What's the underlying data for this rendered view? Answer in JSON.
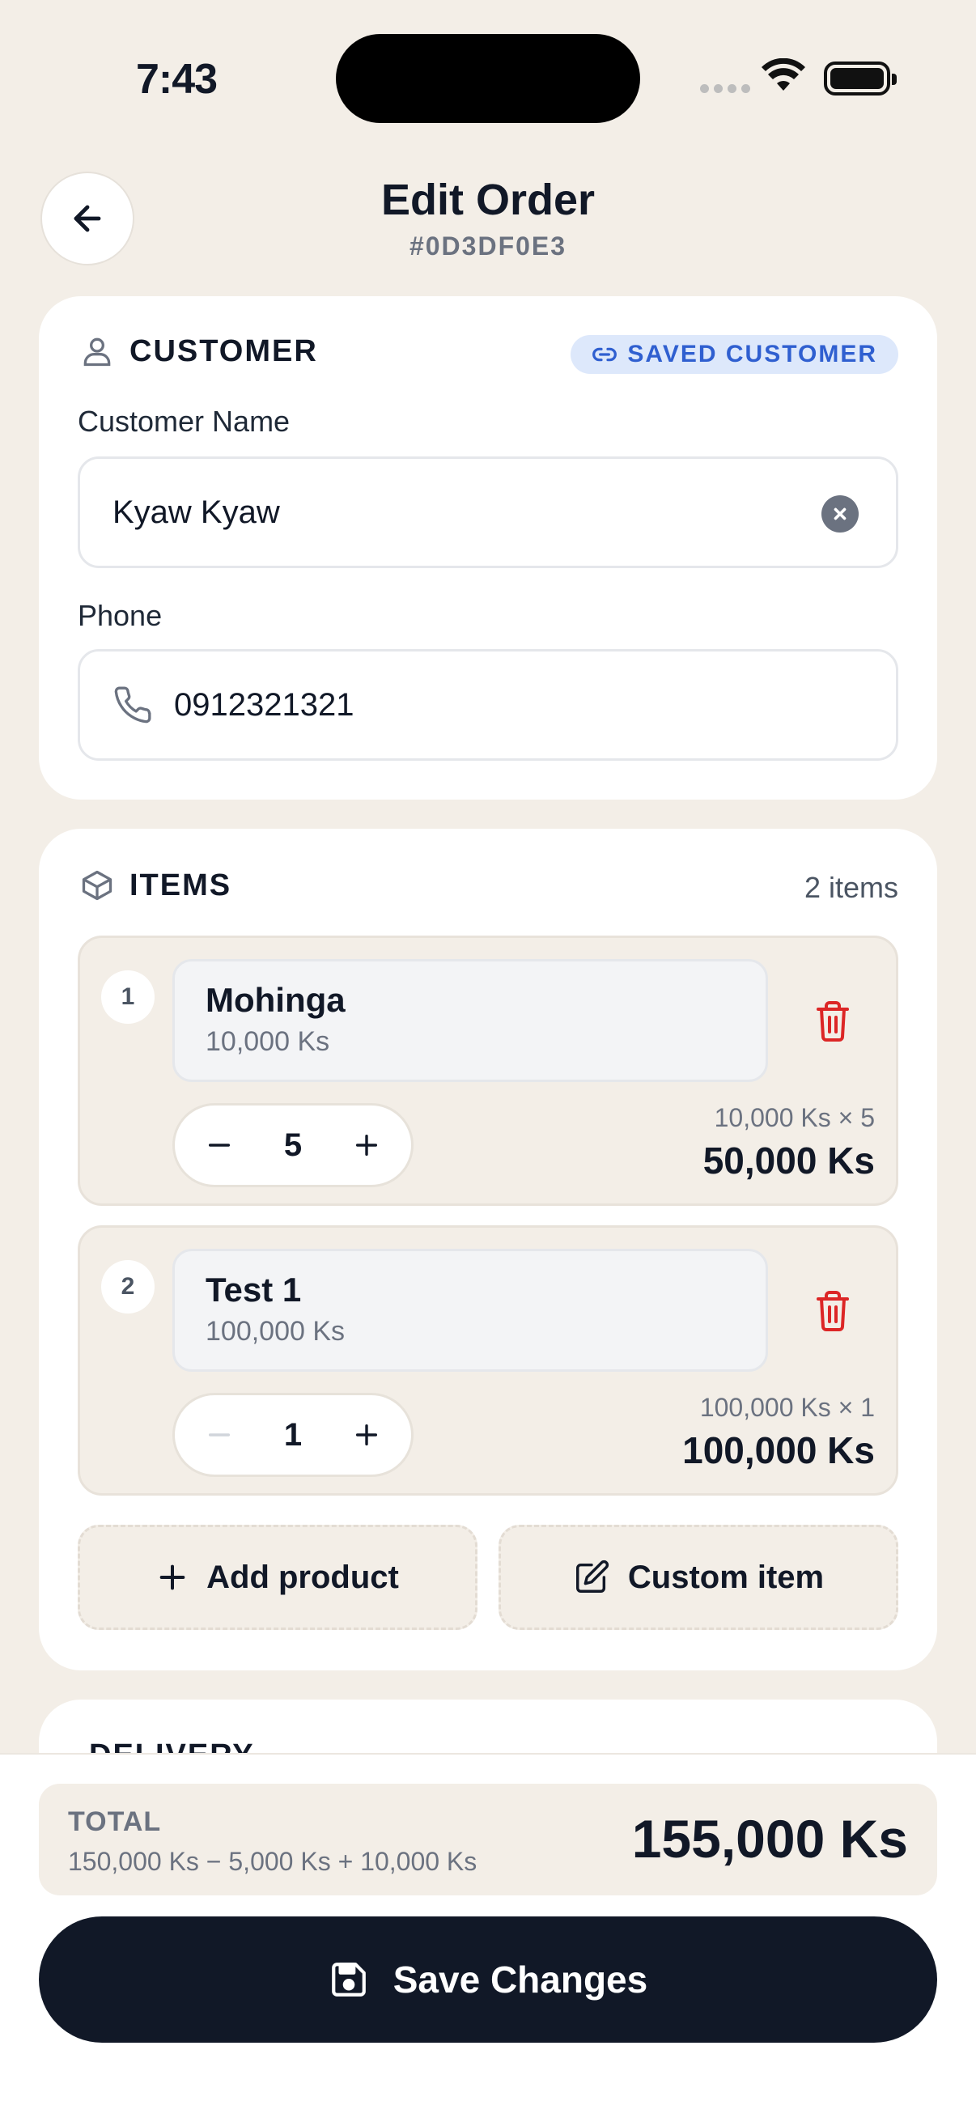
{
  "status_bar": {
    "time": "7:43"
  },
  "header": {
    "title": "Edit Order",
    "order_id": "#0D3DF0E3"
  },
  "customer": {
    "section_title": "CUSTOMER",
    "badge": "SAVED CUSTOMER",
    "name_label": "Customer Name",
    "name_value": "Kyaw Kyaw",
    "phone_label": "Phone",
    "phone_value": "0912321321"
  },
  "items": {
    "section_title": "ITEMS",
    "count_label": "2 items",
    "list": [
      {
        "index": "1",
        "name": "Mohinga",
        "price": "10,000 Ks",
        "qty": "5",
        "calc": "10,000 Ks × 5",
        "line_total": "50,000 Ks"
      },
      {
        "index": "2",
        "name": "Test 1",
        "price": "100,000 Ks",
        "qty": "1",
        "calc": "100,000 Ks × 1",
        "line_total": "100,000 Ks"
      }
    ],
    "add_product_label": "Add product",
    "custom_item_label": "Custom item"
  },
  "delivery": {
    "section_title": "DELIVERY"
  },
  "summary": {
    "total_label": "TOTAL",
    "formula": "150,000 Ks − 5,000 Ks + 10,000 Ks",
    "total_amount": "155,000 Ks"
  },
  "actions": {
    "save_label": "Save Changes"
  },
  "colors": {
    "background": "#F3EEE7",
    "primary": "#111827",
    "accent_blue": "#2F5FD0",
    "danger": "#DC2626"
  }
}
